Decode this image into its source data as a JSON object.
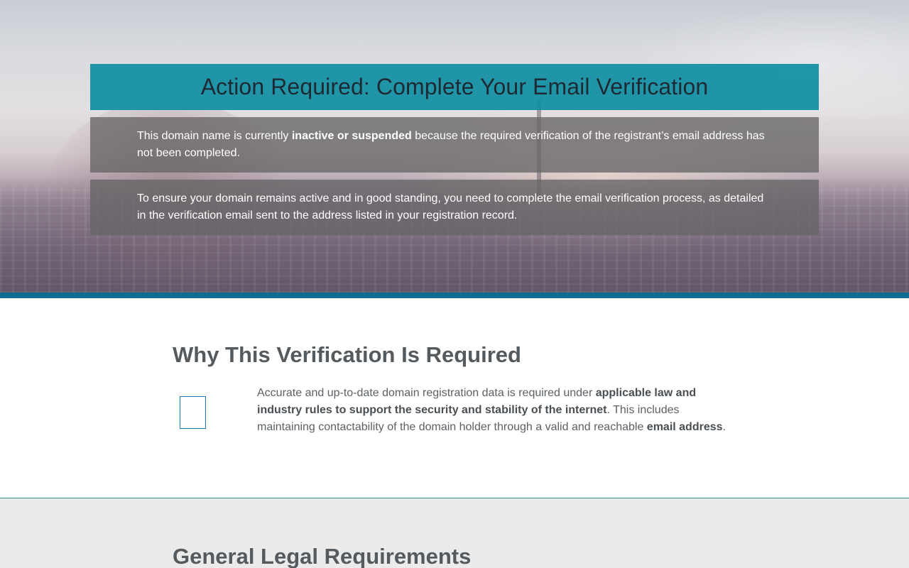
{
  "hero": {
    "title": "Action Required: Complete Your Email Verification",
    "notice1": {
      "before": "This domain name is currently ",
      "bold": "inactive or suspended",
      "after": " because the required verification of the registrant’s email address has not been completed."
    },
    "notice2": {
      "text": "To ensure your domain remains active and in good standing, you need to complete the email verification process, as detailed in the verification email sent to the address listed in your registration record."
    }
  },
  "why": {
    "heading": "Why This Verification Is Required",
    "icon": "document-icon",
    "paragraph": {
      "part1": "Accurate and up-to-date domain registration data is required under ",
      "bold1": "applicable law and industry rules to support the security and stability of the internet",
      "part2": ". This includes maintaining contactability of the domain holder through a valid and reachable ",
      "bold2": "email address",
      "part3": "."
    }
  },
  "legal": {
    "heading": "General Legal Requirements"
  },
  "colors": {
    "banner_teal": "#118fa3",
    "accent_blue": "#106d92",
    "icon_blue": "#1f7fb5",
    "divider_green": "#2f8f86",
    "heading_gray": "#555a5e"
  }
}
